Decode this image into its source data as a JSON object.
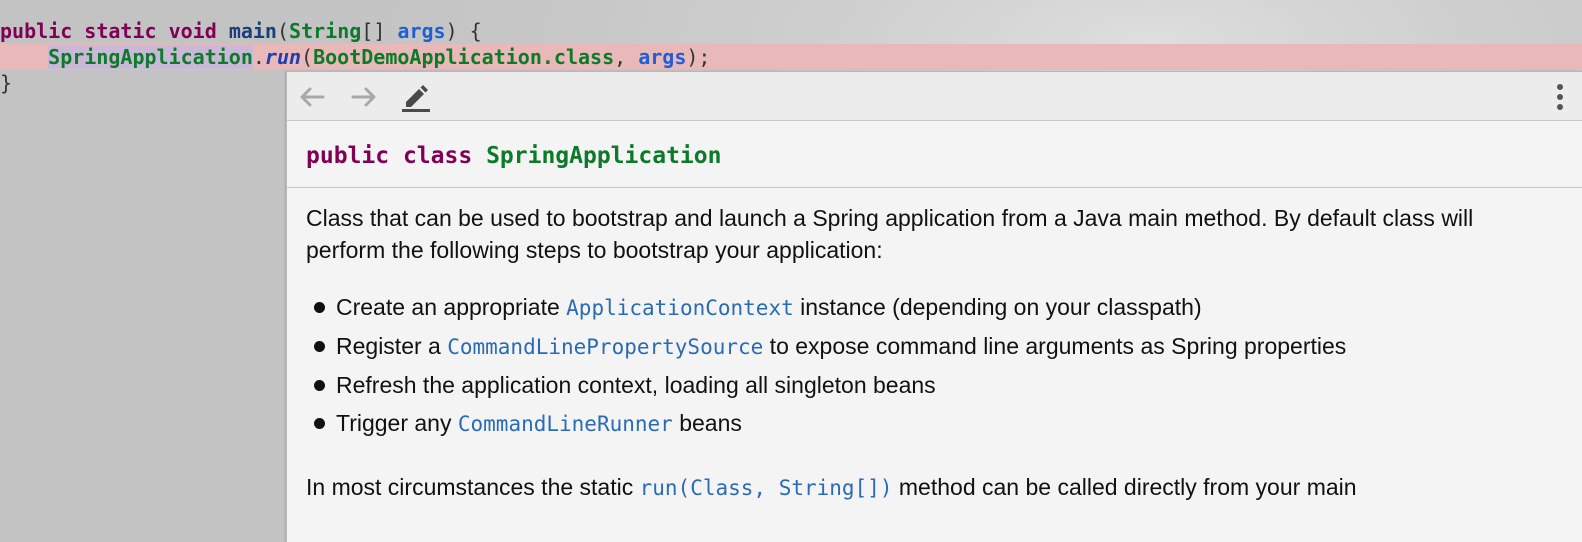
{
  "code": {
    "line1": {
      "t1": "public",
      "t2": "static",
      "t3": "void",
      "t4": "main",
      "t5": "(",
      "t6": "String",
      "t7": "[] ",
      "t8": "args",
      "t9": ") {"
    },
    "line2": {
      "indent": "    ",
      "t1": "SpringApplication",
      "t2": ".",
      "t3": "run",
      "t4": "(",
      "t5": "BootDemoApplication.class",
      "t6": ", ",
      "t7": "args",
      "t8": ");"
    },
    "line3": {
      "t1": "}"
    }
  },
  "popup": {
    "toolbar": {
      "back_icon": "arrow-left-icon",
      "forward_icon": "arrow-right-icon",
      "edit_icon": "pencil-icon",
      "more_icon": "vertical-dots-icon"
    },
    "signature": {
      "kw1": "public",
      "kw2": "class",
      "name": "SpringApplication"
    },
    "paragraph1": "Class that can be used to bootstrap and launch a Spring application from a Java main method. By default class will perform the following steps to bootstrap your application:",
    "list": [
      {
        "pre": "Create an appropriate ",
        "link": "ApplicationContext",
        "post": " instance (depending on your classpath)"
      },
      {
        "pre": "Register a ",
        "link": "CommandLinePropertySource",
        "post": " to expose command line arguments as Spring properties"
      },
      {
        "pre": "Refresh the application context, loading all singleton beans",
        "link": "",
        "post": ""
      },
      {
        "pre": "Trigger any ",
        "link": "CommandLineRunner",
        "post": " beans"
      }
    ],
    "paragraph2": {
      "pre": "In most circumstances the static ",
      "link": "run(Class, String[])",
      "post": " method can be called directly from your main"
    }
  },
  "colors": {
    "keyword": "#7f0055",
    "type": "#0d7a2a",
    "param": "#1f5fd6",
    "link": "#2a6bb5",
    "highlight_line": "#e9b8b8"
  }
}
